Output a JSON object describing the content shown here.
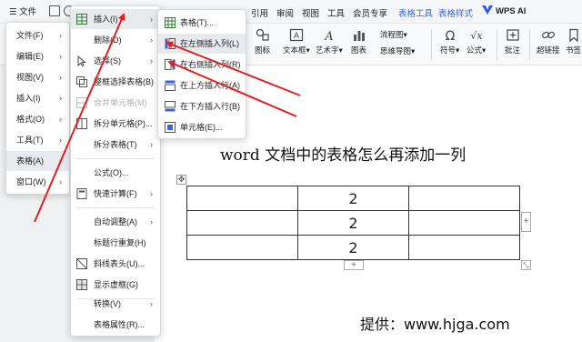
{
  "ribbon": {
    "menu_button": "☰ 文件",
    "tabs": [
      "引用",
      "审阅",
      "视图",
      "工具",
      "会员专享"
    ],
    "context_tabs": [
      "表格工具",
      "表格样式"
    ],
    "wps_ai": "WPS AI"
  },
  "toolbar": {
    "tools": [
      {
        "label": "图标",
        "icon": "shapes-icon"
      },
      {
        "label": "文本框▾",
        "icon": "textbox-icon"
      },
      {
        "label": "艺术字▾",
        "icon": "wordart-icon"
      },
      {
        "label": "图表",
        "icon": "chart-icon"
      },
      {
        "label": "符号▾",
        "icon": "omega-icon"
      },
      {
        "label": "公式▾",
        "icon": "formula-icon"
      },
      {
        "label": "批注",
        "icon": "comment-icon"
      },
      {
        "label": "超链接",
        "icon": "link-icon"
      },
      {
        "label": "书签",
        "icon": "bookmark-icon"
      }
    ],
    "flowchart": "流程图▾",
    "mindmap": "思维导图▾"
  },
  "file_menu": {
    "items": [
      {
        "label": "文件(F)"
      },
      {
        "label": "编辑(E)"
      },
      {
        "label": "视图(V)"
      },
      {
        "label": "插入(I)"
      },
      {
        "label": "格式(O)"
      },
      {
        "label": "工具(T)"
      },
      {
        "label": "表格(A)"
      },
      {
        "label": "窗口(W)"
      }
    ]
  },
  "table_menu": {
    "items": [
      {
        "label": "插入(I)",
        "arrow": true,
        "active": true
      },
      {
        "label": "删除(D)",
        "arrow": true
      },
      {
        "label": "选择(S)",
        "arrow": true
      },
      {
        "label": "整框选择表格(B)"
      },
      {
        "label": "合并单元格(M)",
        "disabled": true
      },
      {
        "label": "拆分单元格(P)..."
      },
      {
        "label": "拆分表格(T)",
        "arrow": true
      },
      {
        "label": "公式(O)..."
      },
      {
        "label": "快速计算(F)",
        "arrow": true
      },
      {
        "label": "自动调整(A)",
        "arrow": true
      },
      {
        "label": "标题行重复(H)"
      },
      {
        "label": "斜线表头(U)..."
      },
      {
        "label": "显示虚框(G)"
      },
      {
        "label": "转换(V)",
        "arrow": true
      },
      {
        "label": "表格属性(R)..."
      }
    ]
  },
  "insert_menu": {
    "items": [
      {
        "label": "表格(T)..."
      },
      {
        "label": "在左侧插入列(L)",
        "active": true
      },
      {
        "label": "在右侧插入列(R)"
      },
      {
        "label": "在上方插入行(A)"
      },
      {
        "label": "在下方插入行(B)"
      },
      {
        "label": "单元格(E)..."
      }
    ]
  },
  "document": {
    "title": "word 文档中的表格怎么再添加一列",
    "table": [
      [
        "",
        "2",
        ""
      ],
      [
        "",
        "2",
        ""
      ],
      [
        "",
        "2",
        ""
      ]
    ],
    "credit": "提供：www.hjga.com"
  },
  "colors": {
    "accent": "#3b64d8",
    "arrow": "#e02020"
  }
}
